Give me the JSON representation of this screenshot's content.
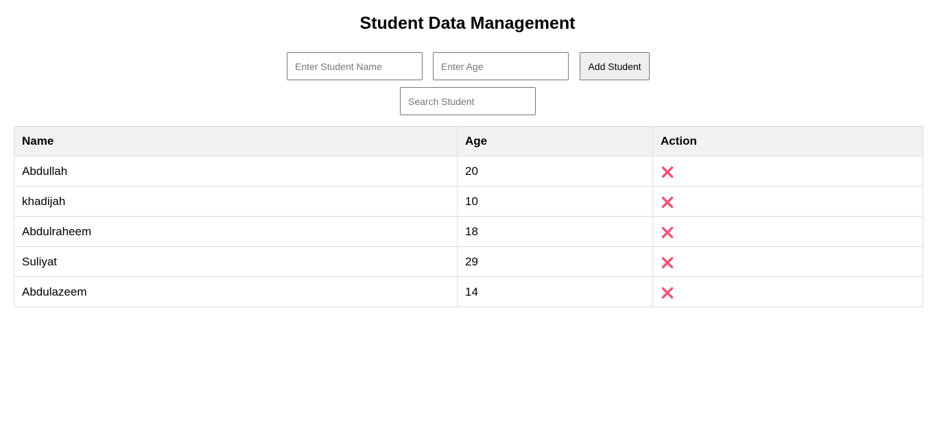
{
  "page": {
    "title": "Student Data Management"
  },
  "form": {
    "name_placeholder": "Enter Student Name",
    "name_value": "",
    "age_placeholder": "Enter Age",
    "age_value": "",
    "add_label": "Add Student",
    "search_placeholder": "Search Student",
    "search_value": ""
  },
  "table": {
    "headers": {
      "name": "Name",
      "age": "Age",
      "action": "Action"
    },
    "rows": [
      {
        "name": "Abdullah",
        "age": "20"
      },
      {
        "name": "khadijah",
        "age": "10"
      },
      {
        "name": "Abdulraheem",
        "age": "18"
      },
      {
        "name": "Suliyat",
        "age": "29"
      },
      {
        "name": "Abdulazeem",
        "age": "14"
      }
    ],
    "delete_icon": "cross-mark-icon"
  },
  "colors": {
    "delete_icon": "#f0567a",
    "header_bg": "#f2f2f2",
    "border": "#dddddd"
  }
}
